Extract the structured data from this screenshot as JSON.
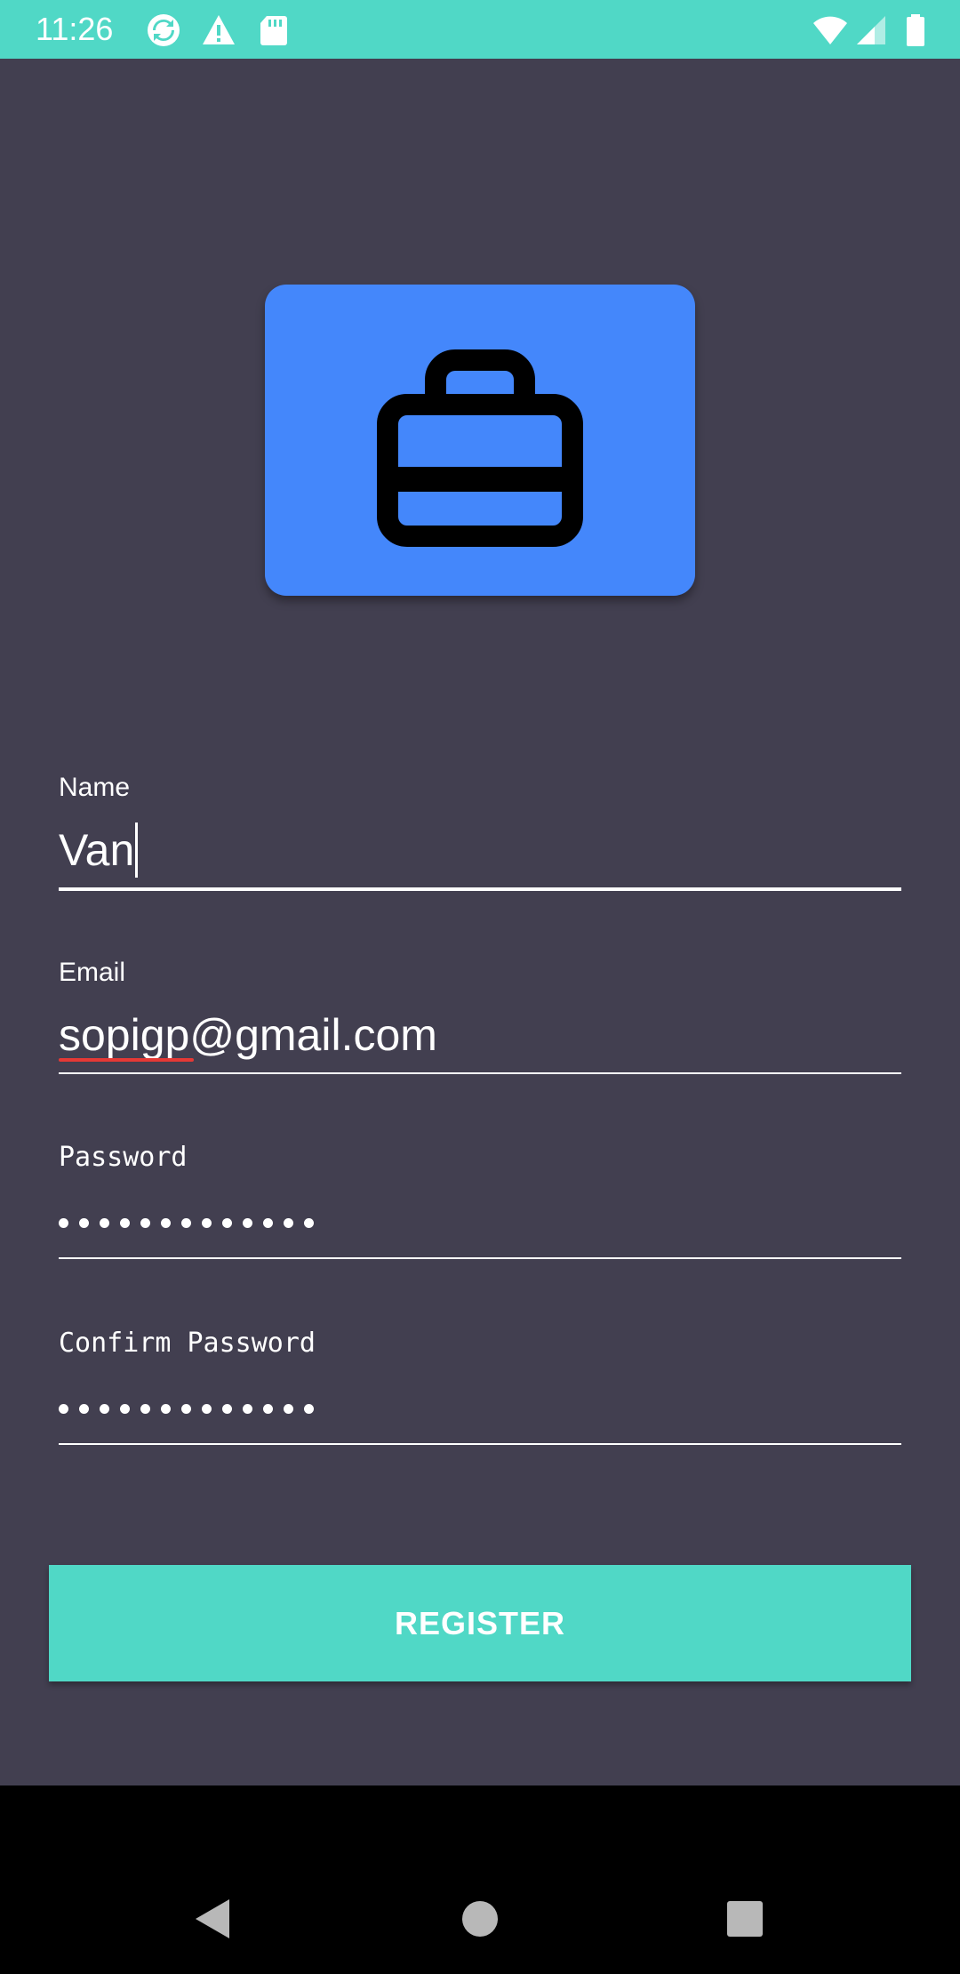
{
  "status_bar": {
    "time": "11:26",
    "background": "#50d8c6",
    "icons_left": [
      "sync-icon",
      "warning-icon",
      "sd-card-icon"
    ],
    "icons_right": [
      "wifi-icon",
      "signal-icon",
      "battery-icon"
    ]
  },
  "logo": {
    "icon": "briefcase-icon",
    "background": "#4487fb"
  },
  "form": {
    "name": {
      "label": "Name",
      "value": "Van"
    },
    "email": {
      "label": "Email",
      "value": "sopigp@gmail.com"
    },
    "password": {
      "label": "Password",
      "masked_length": 13
    },
    "confirm_password": {
      "label": "Confirm Password",
      "masked_length": 13
    }
  },
  "register_button": {
    "label": "REGISTER",
    "background": "#50d8c6"
  },
  "nav_bar": {
    "buttons": [
      "back-icon",
      "home-icon",
      "recents-icon"
    ]
  },
  "colors": {
    "page_background": "#423f50",
    "accent": "#50d8c6",
    "spellcheck_underline": "#e53935"
  }
}
